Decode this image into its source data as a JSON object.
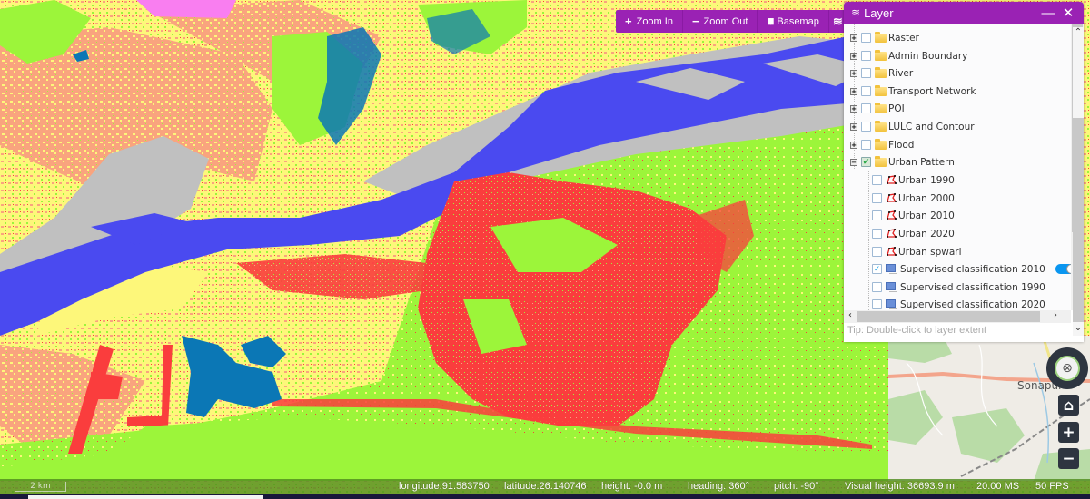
{
  "toolbar": {
    "buttons": [
      {
        "icon": "+",
        "label": "Zoom In"
      },
      {
        "icon": "−",
        "label": "Zoom Out"
      },
      {
        "icon": "▮▮",
        "label": "Basemap"
      },
      {
        "icon": "≋",
        "label": ""
      }
    ]
  },
  "layer_panel": {
    "title": "Layer",
    "minimize": "—",
    "close": "✕",
    "items": [
      {
        "label": "Raster",
        "type": "folder",
        "expanded": false,
        "checked": false
      },
      {
        "label": "Admin Boundary",
        "type": "folder",
        "expanded": false,
        "checked": false
      },
      {
        "label": "River",
        "type": "folder",
        "expanded": false,
        "checked": false
      },
      {
        "label": "Transport Network",
        "type": "folder",
        "expanded": false,
        "checked": false
      },
      {
        "label": "POI",
        "type": "folder",
        "expanded": false,
        "checked": false
      },
      {
        "label": "LULC and Contour",
        "type": "folder",
        "expanded": false,
        "checked": false
      },
      {
        "label": "Flood",
        "type": "folder",
        "expanded": false,
        "checked": false
      },
      {
        "label": "Urban Pattern",
        "type": "folder",
        "expanded": true,
        "checked": true
      },
      {
        "label": "Urban 1990",
        "type": "vector",
        "checked": false
      },
      {
        "label": "Urban 2000",
        "type": "vector",
        "checked": false
      },
      {
        "label": "Urban 2010",
        "type": "vector",
        "checked": false
      },
      {
        "label": "Urban 2020",
        "type": "vector",
        "checked": false
      },
      {
        "label": "Urban spwarl",
        "type": "vector",
        "checked": false
      },
      {
        "label": "Supervised classification 2010",
        "type": "raster",
        "checked": true,
        "opacity": 1.0
      },
      {
        "label": "Supervised classification 1990",
        "type": "raster",
        "checked": false
      },
      {
        "label": "Supervised classification 2020",
        "type": "raster",
        "checked": false
      }
    ],
    "tip": "Tip: Double-click to layer extent"
  },
  "basemap": {
    "place_label": "Sonapur"
  },
  "nav": {
    "home": "⌂",
    "zoom_in": "+",
    "zoom_out": "−",
    "compass": "⊗"
  },
  "status": {
    "scale": "2 km",
    "longitude": "longitude:91.583750",
    "latitude": "latitude:26.140746",
    "height": "height: -0.0 m",
    "heading": "heading: 360°",
    "pitch": "pitch: -90°",
    "visual_height": "Visual height: 36693.9 m",
    "ms": "20.00 MS",
    "fps": "50 FPS"
  },
  "colors": {
    "accent": "#9a22b4",
    "water": "#4a4af0",
    "sandbar": "#c0c0c0",
    "urban": "#fa3d3d",
    "vegetation": "#9cf53a",
    "agriculture": "#fdf77a",
    "bare": "#f9a47e",
    "wetland": "#0b77b5",
    "other": "#f97ef0"
  }
}
